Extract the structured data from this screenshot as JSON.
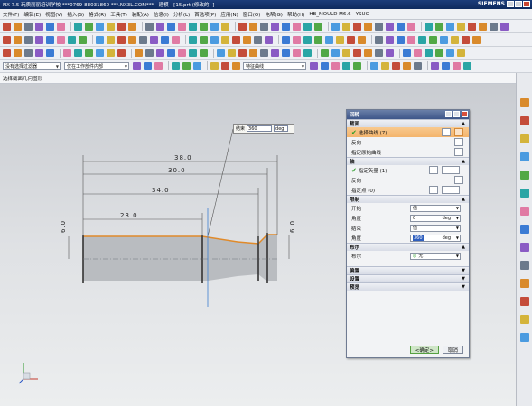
{
  "window": {
    "title": "NX 7.5 玩质丽丽培训学校  ***0769-88031860  ***.NX3L.COM***  - 建模 - [15.prt (修改的) ]",
    "brand": "SIEMENS"
  },
  "menu": [
    "文件(F)",
    "编辑(E)",
    "视图(V)",
    "插入(S)",
    "格式(R)",
    "工具(T)",
    "装配(A)",
    "信息(I)",
    "分析(L)",
    "首选项(P)",
    "应用(N)",
    "窗口(O)",
    "电帮(G)",
    "帮助(H)",
    "HB_MOULD M6.6",
    "YSUG"
  ],
  "filters": {
    "type_filter": "没有选择过滤器",
    "scope_filter": "仅在工作部件内部",
    "curve_rule": "特征曲线"
  },
  "cue_line": "选择截面几何图形",
  "callout": {
    "label": "结束",
    "value": "360",
    "unit": "deg"
  },
  "dimensions": {
    "d38": "38.0",
    "d30": "30.0",
    "d34": "34.0",
    "d23": "23.0",
    "dleft": "6.0",
    "dright": "6.0"
  },
  "dialog": {
    "title": "回转",
    "sections": {
      "section": "截面",
      "axis": "轴",
      "limits": "限制",
      "boolean": "布尔",
      "offset": "偏置",
      "settings": "设置",
      "preview": "预览"
    },
    "rows": {
      "select_curve": "选择曲线 (7)",
      "reverse1": "反向",
      "origin_curve": "指定原始曲线",
      "specify_vector": "指定矢量 (1)",
      "reverse2": "反向",
      "specify_point": "指定点 (0)"
    },
    "limits": {
      "start_label": "开始",
      "start_value": "值",
      "angle1_label": "角度",
      "angle1_value": "0",
      "end_label": "结束",
      "end_value": "值",
      "angle2_label": "角度",
      "angle2_value": "360",
      "unit": "deg"
    },
    "boolean": {
      "label": "布尔",
      "value": "无"
    },
    "buttons": {
      "ok": "<确定>",
      "cancel": "取消"
    }
  }
}
